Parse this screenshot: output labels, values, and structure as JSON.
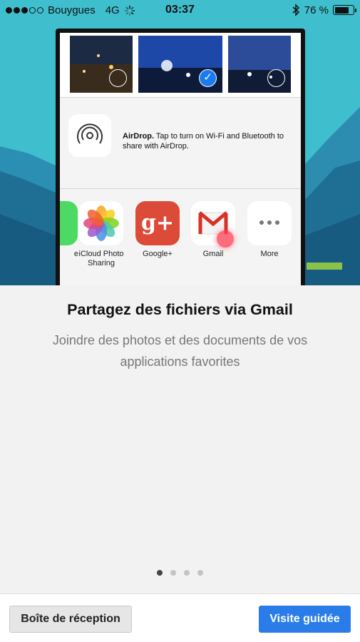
{
  "status_bar": {
    "carrier": "Bouygues",
    "network": "4G",
    "time": "03:37",
    "battery": "76 %",
    "battery_level": 0.76,
    "icons": [
      "signal-dots-icon",
      "loading-spinner-icon",
      "bluetooth-icon",
      "battery-icon"
    ]
  },
  "illustration": {
    "airdrop": {
      "title": "AirDrop.",
      "text": " Tap to turn on Wi-Fi and Bluetooth to share with AirDrop."
    },
    "apps": [
      {
        "name": "messages-partial",
        "label": "e"
      },
      {
        "name": "icloud-photo-sharing",
        "label_line1": "iCloud Photo",
        "label_line2": "Sharing"
      },
      {
        "name": "google-plus",
        "label": "Google+",
        "glyph": "g+"
      },
      {
        "name": "gmail",
        "label": "Gmail"
      },
      {
        "name": "more",
        "label": "More"
      }
    ],
    "colors": {
      "sky": "#3fbfce",
      "gplus": "#dc4a38",
      "gmail_red": "#d93025",
      "select_blue": "#1a7cf2"
    }
  },
  "onboarding": {
    "title": "Partagez des fichiers via Gmail",
    "description": "Joindre des photos et des documents de vos applications favorites",
    "page_count": 4,
    "current_page": 1
  },
  "buttons": {
    "inbox_label": "Boîte de réception",
    "tour_label": "Visite guidée",
    "accent": "#2a7de9"
  }
}
